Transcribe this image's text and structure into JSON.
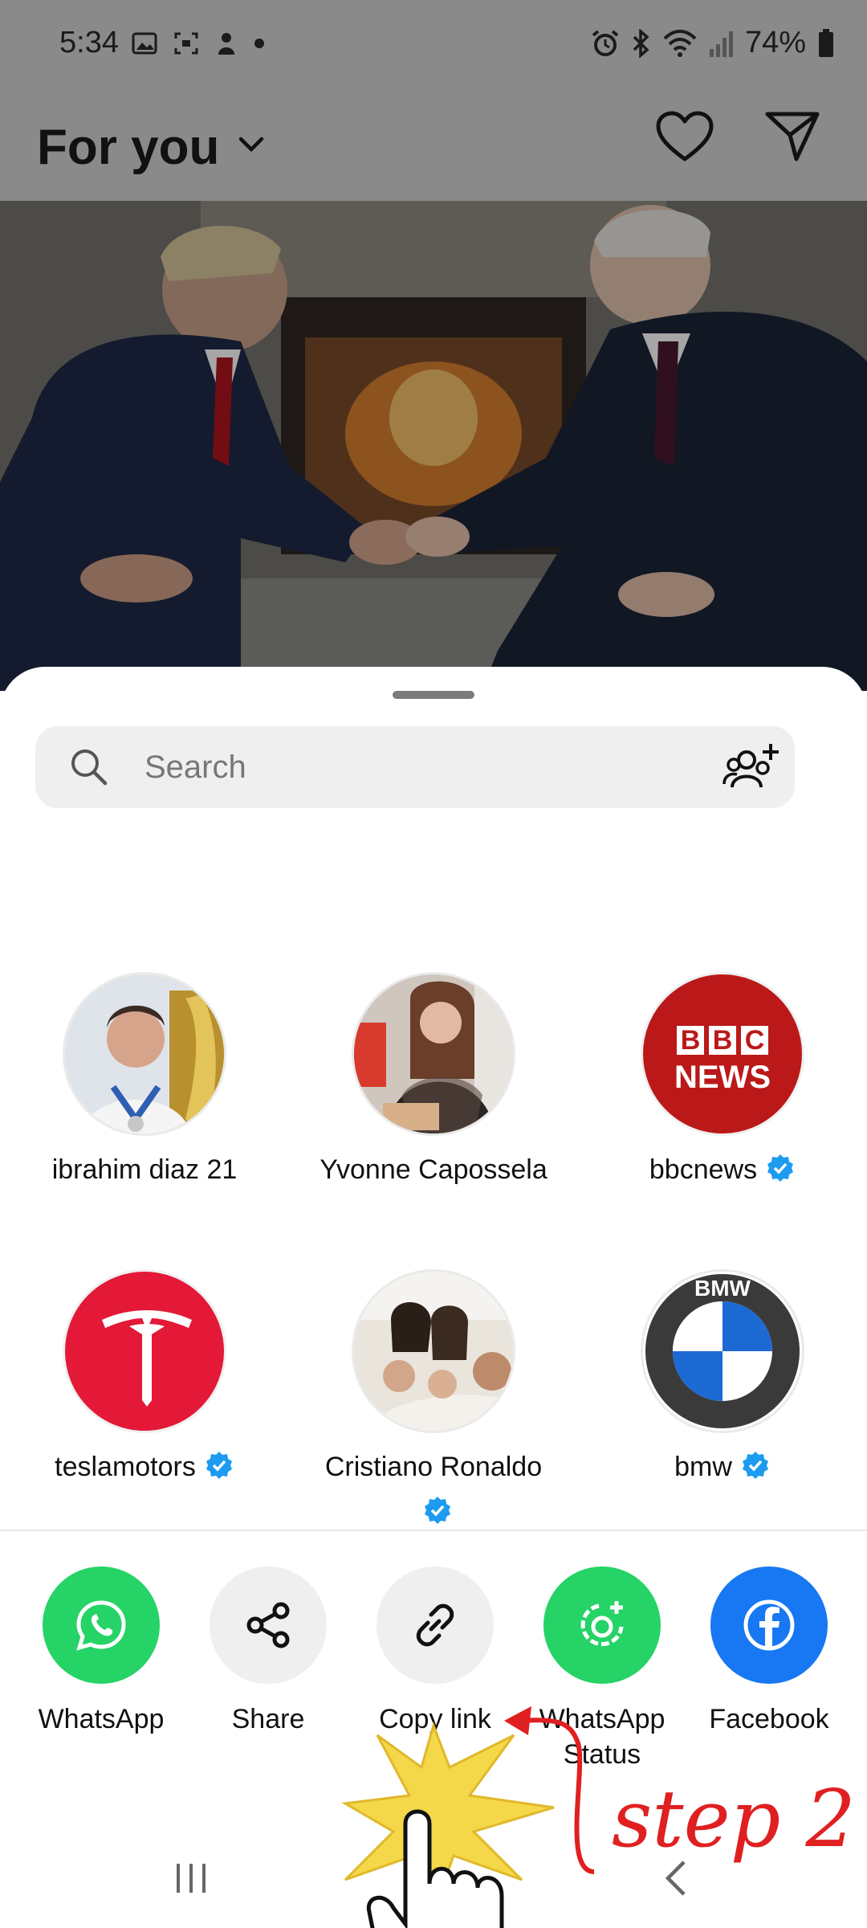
{
  "status_bar": {
    "time": "5:34",
    "battery": "74%",
    "left_icons": [
      "image-icon",
      "screenshot-icon",
      "notification-icon",
      "dot-icon"
    ],
    "right_icons": [
      "alarm-icon",
      "bluetooth-icon",
      "wifi-icon",
      "signal-icon",
      "battery-icon"
    ]
  },
  "header": {
    "feed_title": "For you"
  },
  "search": {
    "placeholder": "Search"
  },
  "contacts": [
    {
      "name": "ibrahim diaz 21",
      "verified": false
    },
    {
      "name": "Yvonne Capossela",
      "verified": false
    },
    {
      "name": "bbcnews",
      "verified": true
    },
    {
      "name": "teslamotors",
      "verified": true
    },
    {
      "name": "Cristiano Ronaldo",
      "verified": true
    },
    {
      "name": "bmw",
      "verified": true
    }
  ],
  "bbc_logo": {
    "line1": "BBC",
    "line2": "NEWS"
  },
  "bmw_logo": {
    "letters": "BMW"
  },
  "share_options": [
    {
      "label": "WhatsApp",
      "icon": "whatsapp-icon",
      "color": "#25d366"
    },
    {
      "label": "Share",
      "icon": "share-icon",
      "color": "#efefef"
    },
    {
      "label": "Copy link",
      "icon": "link-icon",
      "color": "#efefef"
    },
    {
      "label": "WhatsApp Status",
      "icon": "whatsapp-status-icon",
      "color": "#25d366"
    },
    {
      "label": "Facebook",
      "icon": "facebook-icon",
      "color": "#1877f2"
    }
  ],
  "annotation": {
    "step_text": "step 2",
    "color": "#e02020"
  },
  "colors": {
    "verified": "#1d9bf0",
    "scrim": "#8a8a8a"
  }
}
